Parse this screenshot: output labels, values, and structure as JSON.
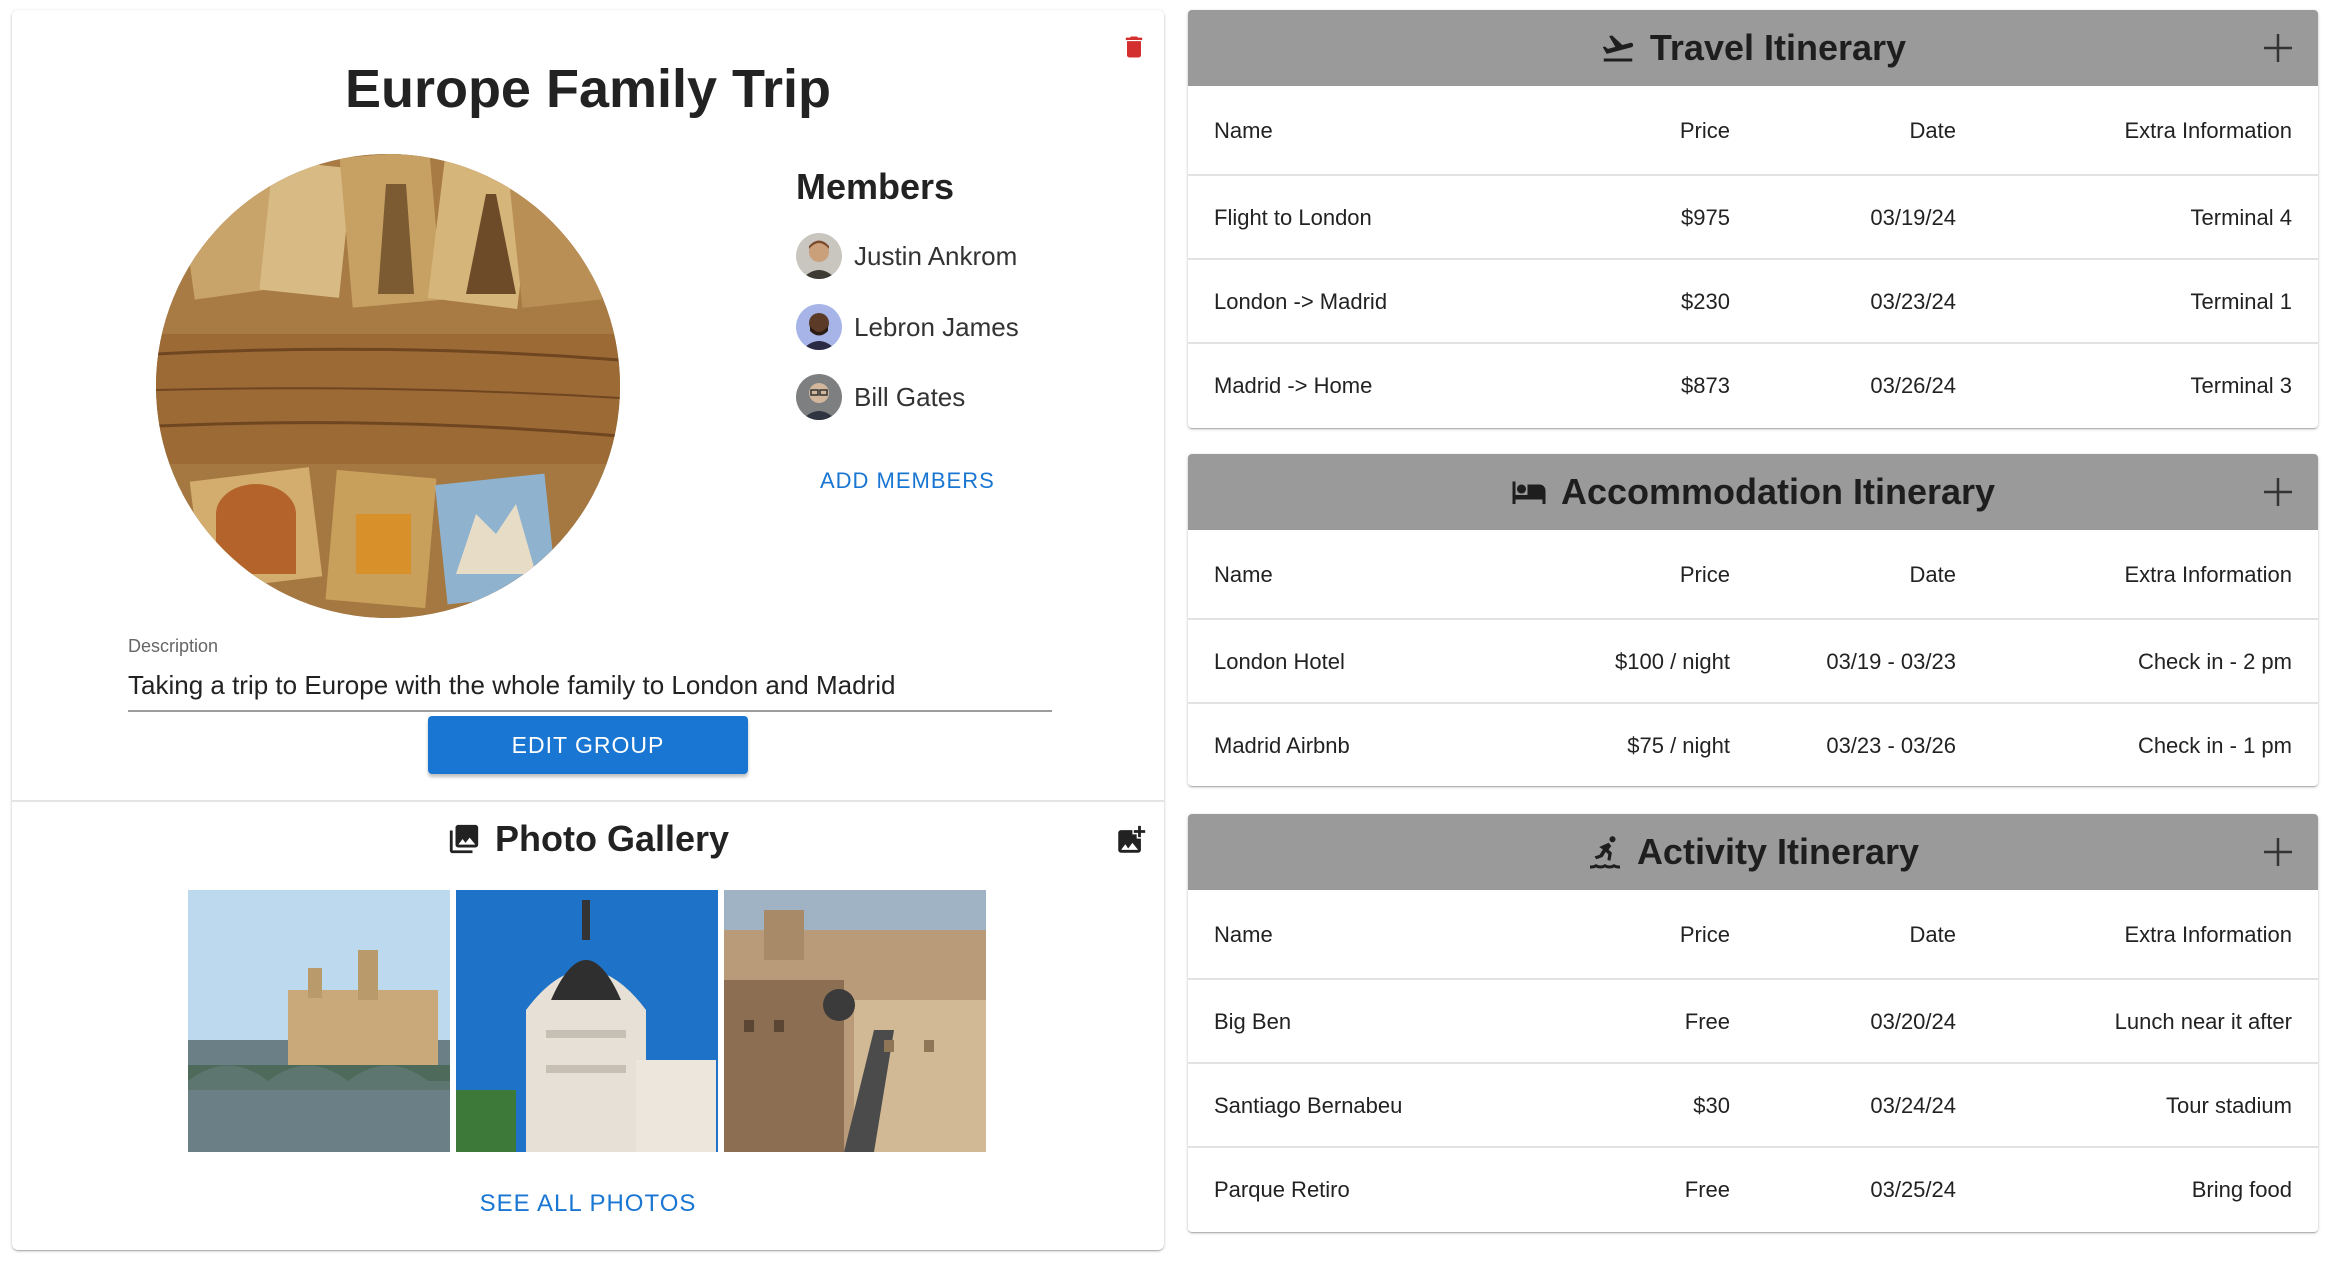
{
  "group": {
    "title": "Europe Family Trip",
    "members_title": "Members",
    "members": [
      {
        "name": "Justin Ankrom"
      },
      {
        "name": "Lebron James"
      },
      {
        "name": "Bill Gates"
      }
    ],
    "add_members_label": "ADD MEMBERS",
    "description_label": "Description",
    "description_value": "Taking a trip to Europe with the whole family to London and Madrid",
    "edit_button_label": "EDIT GROUP",
    "delete_icon": "trash-icon",
    "accent_color": "#1976d2",
    "delete_color": "#d32f2f"
  },
  "gallery": {
    "title": "Photo Gallery",
    "see_all_label": "SEE ALL PHOTOS",
    "icons": [
      "photo-library-icon",
      "add-photo-icon"
    ]
  },
  "itineraries": {
    "columns": [
      "Name",
      "Price",
      "Date",
      "Extra Information"
    ],
    "header_color": "#9a9a9a",
    "travel": {
      "title": "Travel Itinerary",
      "icon": "flight-takeoff-icon",
      "rows": [
        [
          "Flight to London",
          "$975",
          "03/19/24",
          "Terminal 4"
        ],
        [
          "London -> Madrid",
          "$230",
          "03/23/24",
          "Terminal 1"
        ],
        [
          "Madrid -> Home",
          "$873",
          "03/26/24",
          "Terminal 3"
        ]
      ]
    },
    "accommodation": {
      "title": "Accommodation Itinerary",
      "icon": "hotel-bed-icon",
      "rows": [
        [
          "London Hotel",
          "$100 / night",
          "03/19 - 03/23",
          "Check in - 2 pm"
        ],
        [
          "Madrid Airbnb",
          "$75 / night",
          "03/23 - 03/26",
          "Check in - 1 pm"
        ]
      ]
    },
    "activity": {
      "title": "Activity Itinerary",
      "icon": "surfing-icon",
      "rows": [
        [
          "Big Ben",
          "Free",
          "03/20/24",
          "Lunch near it after"
        ],
        [
          "Santiago Bernabeu",
          "$30",
          "03/24/24",
          "Tour stadium"
        ],
        [
          "Parque Retiro",
          "Free",
          "03/25/24",
          "Bring food"
        ]
      ]
    }
  }
}
